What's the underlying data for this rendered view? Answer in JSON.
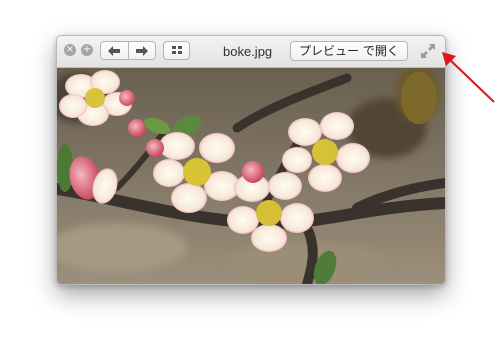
{
  "window": {
    "filename": "boke.jpg",
    "open_button_label": "プレビュー で開く"
  },
  "icons": {
    "close": "close-icon",
    "zoom": "plus-icon",
    "back": "arrow-left-icon",
    "forward": "arrow-right-icon",
    "grid": "grid-icon",
    "fullscreen": "fullscreen-icon",
    "callout": "red-arrow-annotation"
  },
  "colors": {
    "annotation_arrow": "#e0141b",
    "toolbar_bg": "#e8e8e8"
  },
  "image": {
    "subject": "boke-flowers"
  }
}
